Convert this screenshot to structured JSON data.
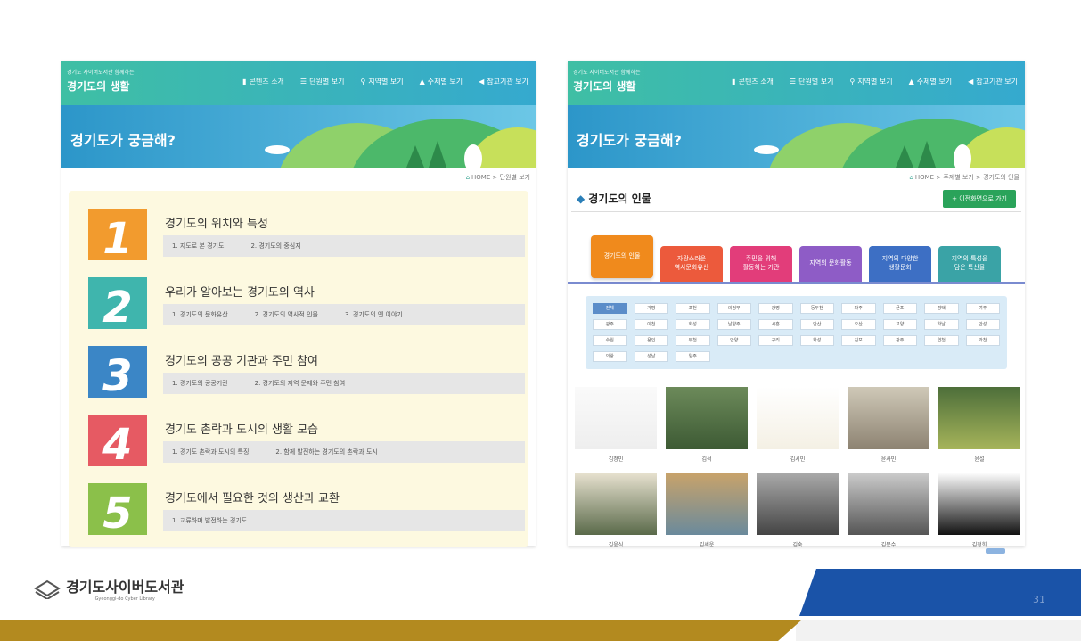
{
  "left": {
    "header": {
      "small": "경기도 사이버도서관 함께하는",
      "brand": "경기도의 생활",
      "nav": [
        "콘텐츠 소개",
        "단원별 보기",
        "지역별 보기",
        "주제별 보기",
        "참고기관 보기"
      ]
    },
    "banner_title": "경기도가 궁금해?",
    "breadcrumb": "HOME > 단원별 보기",
    "units": [
      {
        "num": "1",
        "title": "경기도의 위치와 특성",
        "color": "#f29b2e",
        "subs": [
          "1. 지도로 본 경기도",
          "2. 경기도의 중심지"
        ]
      },
      {
        "num": "2",
        "title": "우리가 알아보는 경기도의 역사",
        "color": "#3fb5ad",
        "subs": [
          "1. 경기도의 문화유산",
          "2. 경기도의 역사적 인물",
          "3. 경기도의 옛 이야기"
        ]
      },
      {
        "num": "3",
        "title": "경기도의 공공 기관과 주민 참여",
        "color": "#3b86c6",
        "subs": [
          "1. 경기도의 공공기관",
          "2. 경기도의 지역 문제와 주민 참여"
        ]
      },
      {
        "num": "4",
        "title": "경기도 촌락과 도시의 생활 모습",
        "color": "#e65a63",
        "subs": [
          "1. 경기도 촌락과 도시의 특징",
          "2. 함께 발전하는 경기도의 촌락과 도시"
        ]
      },
      {
        "num": "5",
        "title": "경기도에서 필요한 것의 생산과 교환",
        "color": "#8bc04a",
        "subs": [
          "1. 교류하며 발전하는 경기도"
        ]
      }
    ]
  },
  "right": {
    "header": {
      "small": "경기도 사이버도서관 함께하는",
      "brand": "경기도의 생활",
      "nav": [
        "콘텐츠 소개",
        "단원별 보기",
        "지역별 보기",
        "주제별 보기",
        "참고기관 보기"
      ]
    },
    "banner_title": "경기도가 궁금해?",
    "breadcrumb": "HOME > 주제별 보기 > 경기도의 인물",
    "section_title": "경기도의 인물",
    "back_button": "+ 이전화면으로 가기",
    "tabs": [
      {
        "label": "경기도의 인물",
        "color": "#f08a1c",
        "active": true
      },
      {
        "label": "자랑스러운\n역사문화유산",
        "color": "#ec5a3c",
        "active": false
      },
      {
        "label": "주민을 위해\n활동하는 기관",
        "color": "#e23d7a",
        "active": false
      },
      {
        "label": "지역의 문화활동",
        "color": "#8e5cc6",
        "active": false
      },
      {
        "label": "지역의 다양한\n생활문화",
        "color": "#3d6fc4",
        "active": false
      },
      {
        "label": "지역의 특성을\n담은 특산물",
        "color": "#3aa3a6",
        "active": false
      }
    ],
    "regions": [
      "전체",
      "가평",
      "포천",
      "의정부",
      "광명",
      "동두천",
      "파주",
      "군포",
      "평택",
      "여주",
      "광주",
      "이천",
      "화성",
      "남양주",
      "시흥",
      "안산",
      "오산",
      "고양",
      "하남",
      "안성",
      "수원",
      "용인",
      "부천",
      "안양",
      "구리",
      "화성",
      "김포",
      "광주",
      "연천",
      "과천",
      "의왕",
      "성남",
      "양주"
    ],
    "people": [
      "김정민",
      "김석",
      "김시민",
      "윤사민",
      "윤설",
      "김윤식",
      "김세운",
      "김숙",
      "김문수",
      "김정희"
    ]
  },
  "footer": {
    "logo": "경기도사이버도서관",
    "logo_sub": "Gyeonggi-do Cyber Library",
    "page": "31"
  },
  "colors": {
    "gold": "#b38a1f",
    "blue": "#1a53a8"
  }
}
